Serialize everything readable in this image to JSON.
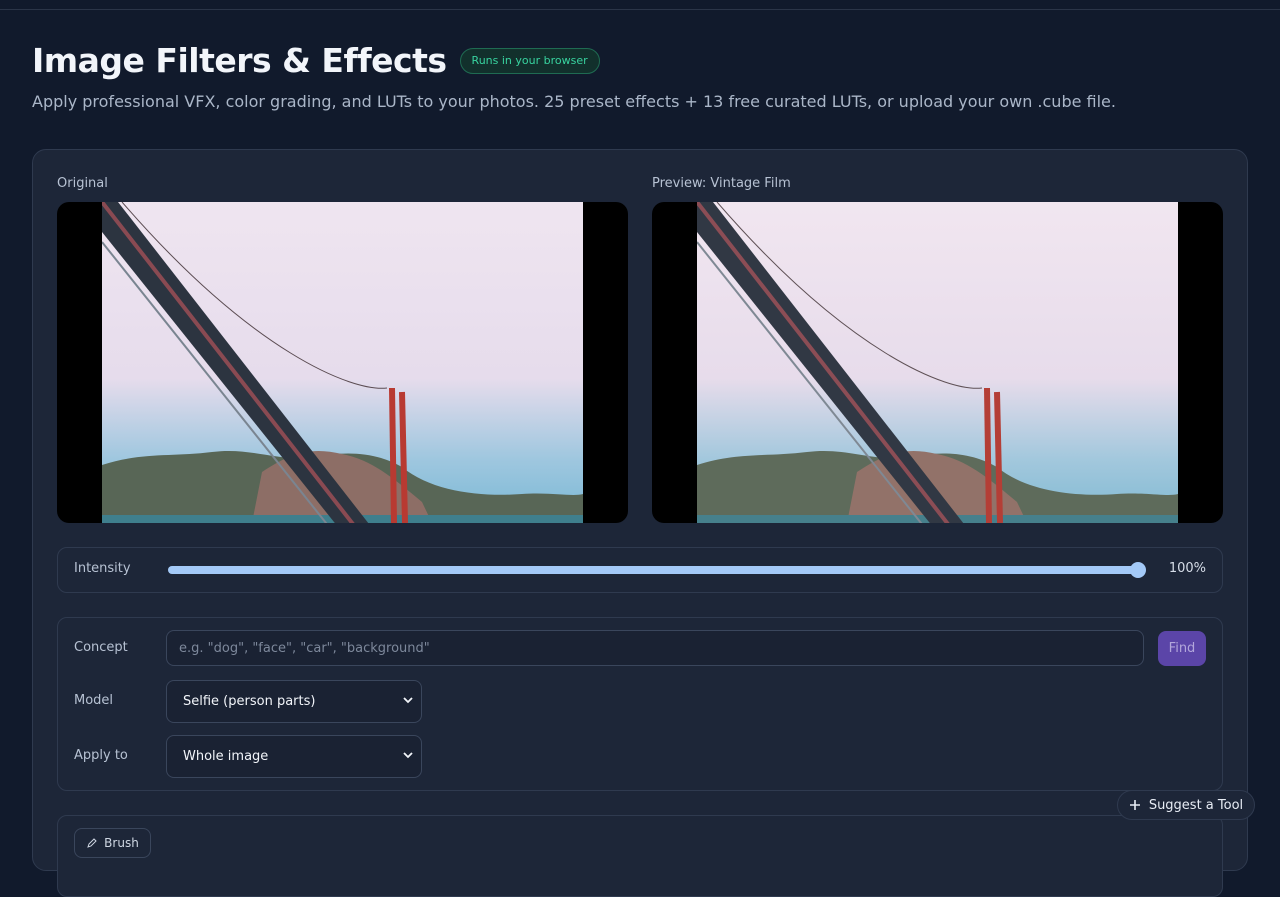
{
  "header": {
    "title": "Image Filters & Effects",
    "badge": "Runs in your browser",
    "subtitle": "Apply professional VFX, color grading, and LUTs to your photos. 25 preset effects + 13 free curated LUTs, or upload your own .cube file."
  },
  "compare": {
    "original_label": "Original",
    "preview_label": "Preview: Vintage Film"
  },
  "intensity": {
    "label": "Intensity",
    "value": 1.0,
    "value_text": "100%"
  },
  "segmentation": {
    "concept_label": "Concept",
    "concept_placeholder": "e.g. \"dog\", \"face\", \"car\", \"background\"",
    "find_label": "Find",
    "model_label": "Model",
    "model_value": "Selfie (person parts)",
    "apply_label": "Apply to",
    "apply_value": "Whole image"
  },
  "tools": {
    "brush_label": "Brush"
  },
  "suggest_label": "Suggest a Tool",
  "colors": {
    "background": "#111a2c",
    "card": "#1d2638",
    "accent": "#a3c9f7",
    "find_button": "#5b45a8",
    "badge_text": "#38d39f"
  }
}
